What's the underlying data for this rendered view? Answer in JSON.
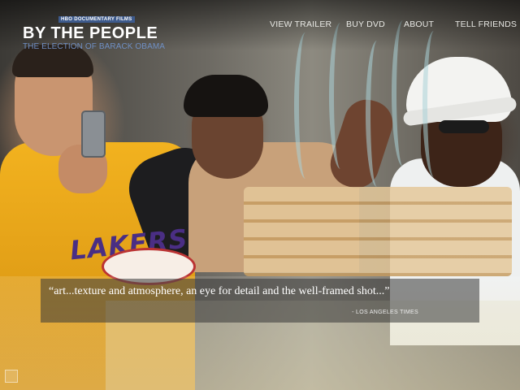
{
  "header": {
    "logo_tag": "HBO DOCUMENTARY FILMS",
    "title": "BY THE PEOPLE",
    "subtitle": "THE ELECTION OF BARACK OBAMA"
  },
  "nav": {
    "items": [
      {
        "label": "VIEW TRAILER"
      },
      {
        "label": "BUY DVD"
      },
      {
        "label": "ABOUT"
      },
      {
        "label": "TELL FRIENDS"
      }
    ]
  },
  "hero": {
    "jersey_text": "LAKERS",
    "quote": "“art...texture and atmosphere, an eye for detail and the well-framed shot...”",
    "quote_source": "- LOS ANGELES TIMES"
  },
  "colors": {
    "logo_tag_bg": "#3d5a8c",
    "subtitle": "#6f8fc4",
    "nav_text": "#e8e8e4"
  },
  "icons": {
    "corner": "square-icon"
  }
}
